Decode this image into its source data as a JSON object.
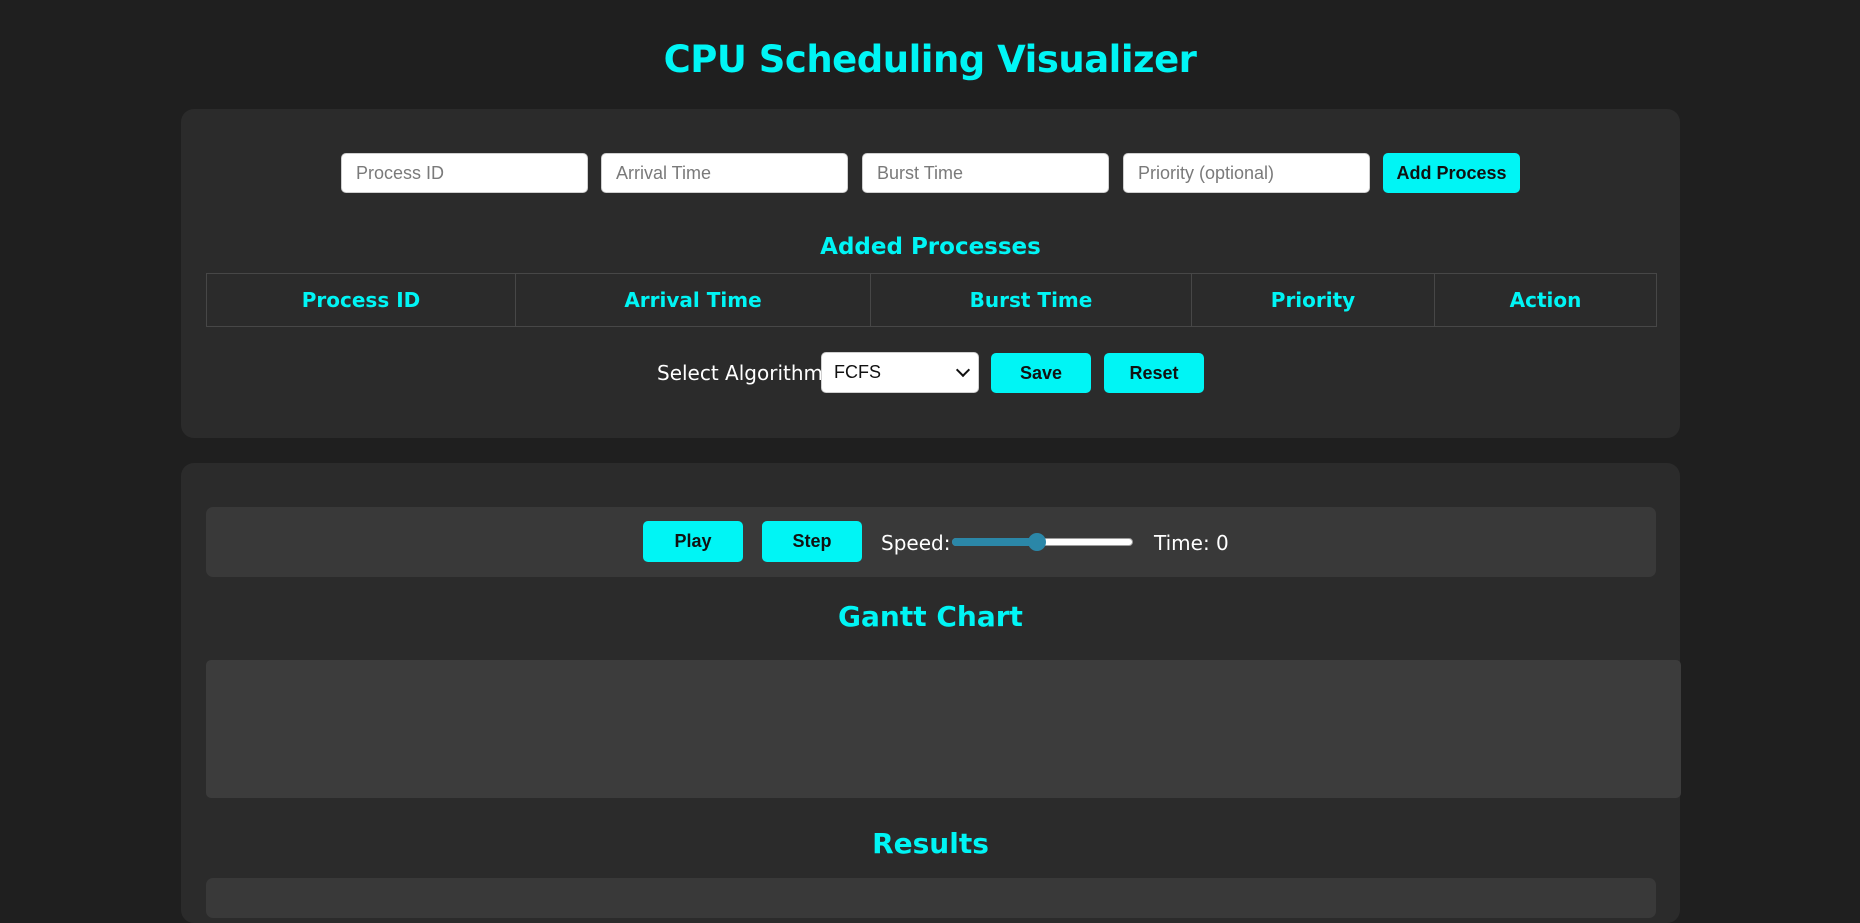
{
  "app": {
    "title": "CPU Scheduling Visualizer"
  },
  "inputs": {
    "process_id": {
      "placeholder": "Process ID",
      "value": ""
    },
    "arrival_time": {
      "placeholder": "Arrival Time",
      "value": ""
    },
    "burst_time": {
      "placeholder": "Burst Time",
      "value": ""
    },
    "priority": {
      "placeholder": "Priority (optional)",
      "value": ""
    },
    "add_label": "Add Process"
  },
  "processes": {
    "title": "Added Processes",
    "columns": [
      "Process ID",
      "Arrival Time",
      "Burst Time",
      "Priority",
      "Action"
    ],
    "rows": []
  },
  "algorithm": {
    "label": "Select Algorithm:",
    "selected": "FCFS",
    "save_label": "Save",
    "reset_label": "Reset"
  },
  "controls": {
    "play_label": "Play",
    "step_label": "Step",
    "speed_label": "Speed:",
    "speed_fraction": 0.47,
    "time_label": "Time: 0"
  },
  "gantt": {
    "title": "Gantt Chart"
  },
  "results": {
    "title": "Results"
  },
  "colors": {
    "accent": "#00f5f5",
    "background": "#1f1f1f",
    "panel": "#2b2b2b",
    "slider": "#2b87a8"
  }
}
